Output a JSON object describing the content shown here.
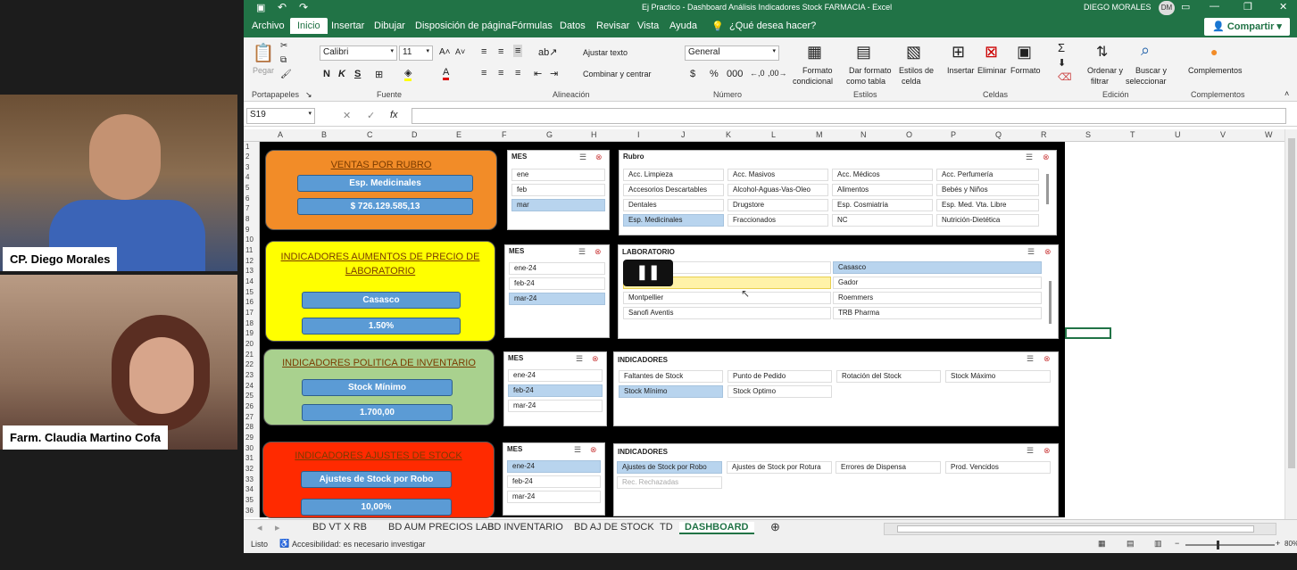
{
  "participants": [
    {
      "name": "CP. Diego Morales"
    },
    {
      "name": "Farm. Claudia Martino Cofa"
    }
  ],
  "window": {
    "title": "Ej Practico - Dashboard Análisis Indicadores Stock FARMACIA - Excel",
    "user": "DIEGO MORALES",
    "user_initials": "DM"
  },
  "menu": {
    "tabs": [
      "Archivo",
      "Inicio",
      "Insertar",
      "Dibujar",
      "Disposición de página",
      "Fórmulas",
      "Datos",
      "Revisar",
      "Vista",
      "Ayuda"
    ],
    "search": "¿Qué desea hacer?",
    "share": "Compartir"
  },
  "ribbon": {
    "paste": "Pegar",
    "font_name": "Calibri",
    "font_size": "11",
    "wrap": "Ajustar texto",
    "merge": "Combinar y centrar",
    "number_format": "General",
    "cond_format": [
      "Formato",
      "condicional"
    ],
    "as_table": [
      "Dar formato",
      "como tabla"
    ],
    "cell_styles": [
      "Estilos de",
      "celda"
    ],
    "insert": "Insertar",
    "delete": "Eliminar",
    "format": "Formato",
    "sort": [
      "Ordenar y",
      "filtrar"
    ],
    "find": [
      "Buscar y",
      "seleccionar"
    ],
    "addins": "Complementos",
    "groups": [
      "Portapapeles",
      "Fuente",
      "Alineación",
      "Número",
      "Estilos",
      "Celdas",
      "Edición",
      "Complementos"
    ]
  },
  "formula_bar": {
    "name_box": "S19",
    "fx": "fx",
    "value": ""
  },
  "columns": [
    "A",
    "B",
    "C",
    "D",
    "E",
    "F",
    "G",
    "H",
    "I",
    "J",
    "K",
    "L",
    "M",
    "N",
    "O",
    "P",
    "Q",
    "R",
    "S",
    "T",
    "U",
    "V",
    "W"
  ],
  "rows": [
    "1",
    "2",
    "3",
    "4",
    "5",
    "6",
    "7",
    "8",
    "9",
    "10",
    "11",
    "12",
    "13",
    "14",
    "15",
    "16",
    "17",
    "18",
    "19",
    "20",
    "21",
    "22",
    "23",
    "24",
    "25",
    "26",
    "27",
    "28",
    "29",
    "30",
    "31",
    "32",
    "33",
    "34",
    "35",
    "36"
  ],
  "cards": [
    {
      "title": "VENTAS POR RUBRO",
      "box1": "Esp. Medicinales",
      "box2": "$ 726.129.585,13"
    },
    {
      "title": "INDICADORES AUMENTOS DE PRECIO DE LABORATORIO",
      "box1": "Casasco",
      "box2": "1.50%"
    },
    {
      "title": "INDICADORES POLITICA DE INVENTARIO",
      "box1": "Stock Mínimo",
      "box2": "1.700,00"
    },
    {
      "title": "INDICADORES AJUSTES DE STOCK",
      "box1": "Ajustes de Stock por Robo",
      "box2": "10,00%"
    }
  ],
  "mes_slicers": [
    {
      "title": "MES",
      "items": [
        "ene",
        "feb",
        "mar"
      ],
      "selected": 2
    },
    {
      "title": "MES",
      "items": [
        "ene-24",
        "feb-24",
        "mar-24"
      ],
      "selected": 2
    },
    {
      "title": "MES",
      "items": [
        "ene-24",
        "feb-24",
        "mar-24"
      ],
      "selected": 1
    },
    {
      "title": "MES",
      "items": [
        "ene-24",
        "feb-24",
        "mar-24"
      ],
      "selected": 0
    }
  ],
  "rubro": {
    "title": "Rubro",
    "items": [
      "Acc. Limpieza",
      "Acc. Masivos",
      "Acc. Médicos",
      "Acc. Perfumería",
      "Accesorios Descartables",
      "Alcohol-Aguas-Vas-Oleo",
      "Alimentos",
      "Bebés y Niños",
      "Dentales",
      "Drugstore",
      "Esp. Cosmiatría",
      "Esp. Med. Vta. Libre",
      "Esp. Medicinales",
      "Fraccionados",
      "NC",
      "Nutrición-Dietética"
    ],
    "selected": 12
  },
  "laboratorio": {
    "title": "LABORATORIO",
    "items": [
      "",
      "Casasco",
      "",
      "Gador",
      "Montpellier",
      "Roemmers",
      "Sanofi Aventis",
      "TRB Pharma"
    ],
    "selected": 1
  },
  "inventario": {
    "title": "INDICADORES",
    "items": [
      "Faltantes de Stock",
      "Punto de Pedido",
      "Rotación del Stock",
      "Stock Máximo",
      "Stock Mínimo",
      "Stock Optimo"
    ],
    "selected": 4
  },
  "ajustes": {
    "title": "INDICADORES",
    "items": [
      "Ajustes de Stock por Robo",
      "Ajustes de Stock por Rotura",
      "Errores de Dispensa",
      "Prod. Vencidos",
      "Rec. Rechazadas"
    ],
    "selected": 0,
    "dimmed": 4
  },
  "sheet_tabs": [
    "BD VT X RB",
    "BD AUM PRECIOS LAB",
    "BD INVENTARIO",
    "BD AJ DE STOCK",
    "TD",
    "DASHBOARD"
  ],
  "active_sheet": "DASHBOARD",
  "status": {
    "ready": "Listo",
    "accessibility": "Accesibilidad: es necesario investigar",
    "zoom": "80%"
  },
  "colors": {
    "excel_green": "#217346",
    "orange": "#f28c28",
    "yellow": "#ffff00",
    "green": "#a9d18e",
    "red": "#ff2a00",
    "slicer_sel": "#b8d4ee",
    "box_blue": "#5b9bd5"
  }
}
